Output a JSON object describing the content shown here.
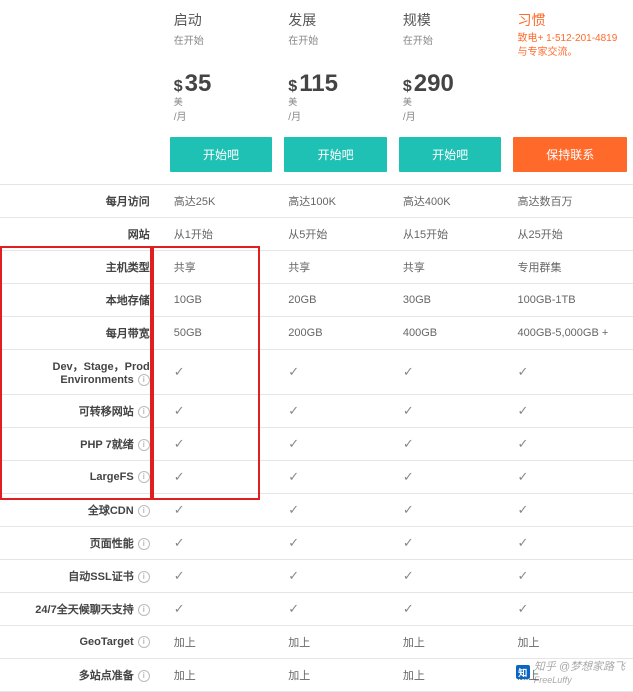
{
  "plans": [
    {
      "name": "启动",
      "start": "在开始",
      "currency": "$",
      "price": "35",
      "unit_top": "美",
      "unit_bot": "/月",
      "btn": "开始吧",
      "btn_class": "teal"
    },
    {
      "name": "发展",
      "start": "在开始",
      "currency": "$",
      "price": "115",
      "unit_top": "美",
      "unit_bot": "/月",
      "btn": "开始吧",
      "btn_class": "teal"
    },
    {
      "name": "规模",
      "start": "在开始",
      "currency": "$",
      "price": "290",
      "unit_top": "美",
      "unit_bot": "/月",
      "btn": "开始吧",
      "btn_class": "teal"
    },
    {
      "name": "习惯",
      "contact1": "致电+ 1-512-201-4819",
      "contact2": "与专家交流。",
      "btn": "保持联系",
      "btn_class": "orange"
    }
  ],
  "rows": [
    {
      "label": "每月访问",
      "info": false,
      "vals": [
        "高达25K",
        "高达100K",
        "高达400K",
        "高达数百万"
      ]
    },
    {
      "label": "网站",
      "info": false,
      "vals": [
        "从1开始",
        "从5开始",
        "从15开始",
        "从25开始"
      ]
    },
    {
      "label": "主机类型",
      "info": false,
      "vals": [
        "共享",
        "共享",
        "共享",
        "专用群集"
      ]
    },
    {
      "label": "本地存储",
      "info": false,
      "vals": [
        "10GB",
        "20GB",
        "30GB",
        "100GB-1TB"
      ]
    },
    {
      "label": "每月带宽",
      "info": false,
      "vals": [
        "50GB",
        "200GB",
        "400GB",
        "400GB-5,000GB +"
      ]
    },
    {
      "label": "Dev，Stage，Prod Environments",
      "info": true,
      "vals": [
        "✓",
        "✓",
        "✓",
        "✓"
      ]
    },
    {
      "label": "可转移网站",
      "info": true,
      "vals": [
        "✓",
        "✓",
        "✓",
        "✓"
      ]
    },
    {
      "label": "PHP 7就绪",
      "info": true,
      "vals": [
        "✓",
        "✓",
        "✓",
        "✓"
      ]
    },
    {
      "label": "LargeFS",
      "info": true,
      "vals": [
        "✓",
        "✓",
        "✓",
        "✓"
      ]
    },
    {
      "label": "全球CDN",
      "info": true,
      "vals": [
        "✓",
        "✓",
        "✓",
        "✓"
      ]
    },
    {
      "label": "页面性能",
      "info": true,
      "vals": [
        "✓",
        "✓",
        "✓",
        "✓"
      ]
    },
    {
      "label": "自动SSL证书",
      "info": true,
      "vals": [
        "✓",
        "✓",
        "✓",
        "✓"
      ]
    },
    {
      "label": "24/7全天候聊天支持",
      "info": true,
      "vals": [
        "✓",
        "✓",
        "✓",
        "✓"
      ]
    },
    {
      "label": "GeoTarget",
      "info": true,
      "vals": [
        "加上",
        "加上",
        "加上",
        "加上"
      ]
    },
    {
      "label": "多站点准备",
      "info": true,
      "vals": [
        "加上",
        "加上",
        "加上",
        "加上"
      ]
    }
  ],
  "watermark": {
    "icon": "知",
    "text": "知乎 @梦想家路飞",
    "sub": "FreeLuffy"
  }
}
